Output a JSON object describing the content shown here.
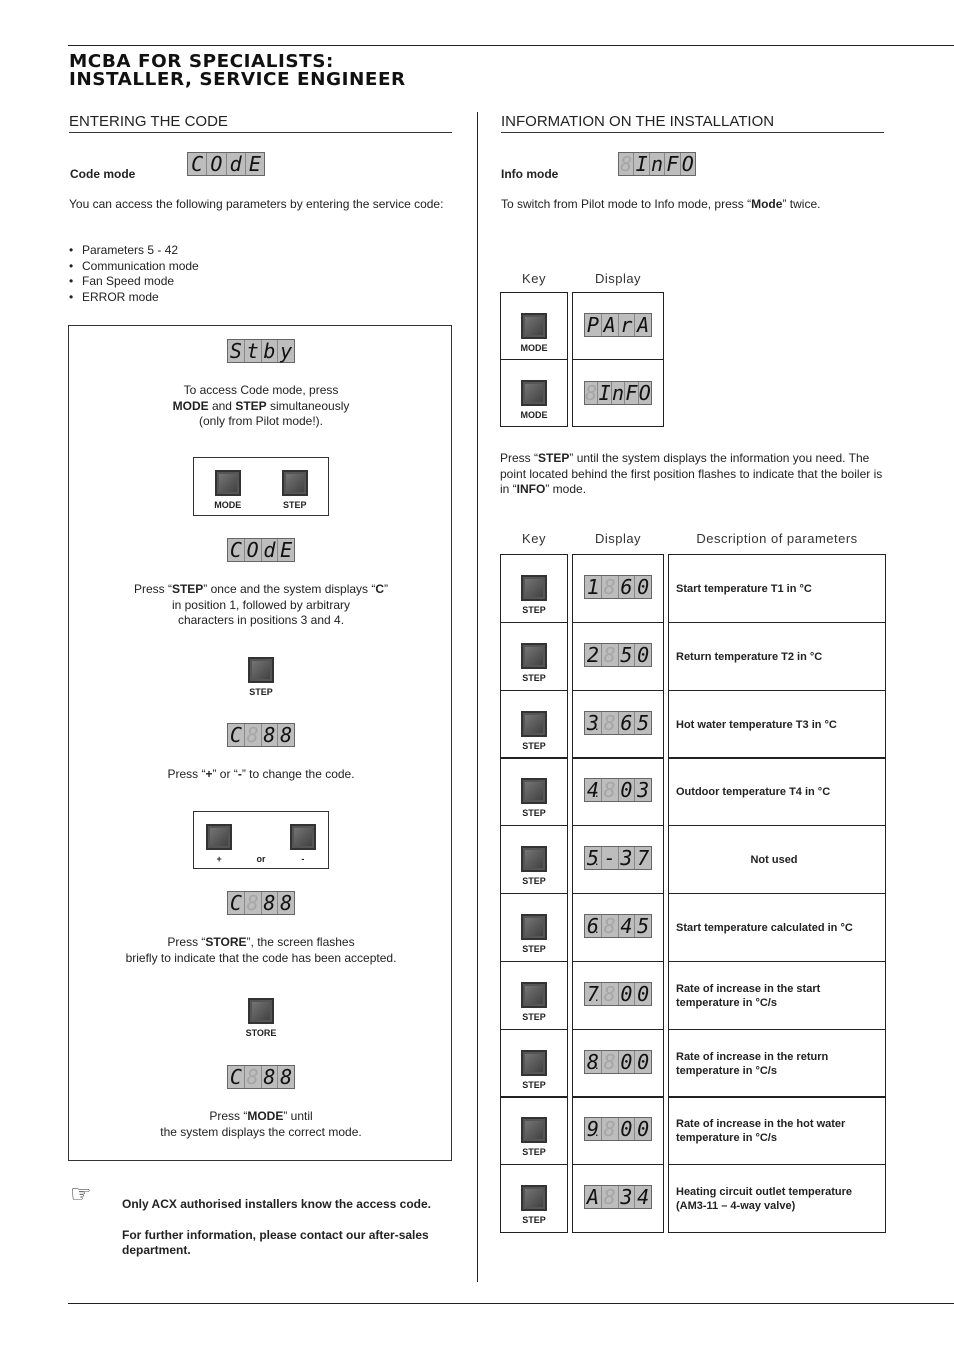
{
  "header": {
    "title_line1": "MCBA FOR SPECIALISTS:",
    "title_line2": "INSTALLER, SERVICE ENGINEER"
  },
  "left": {
    "section_title": "ENTERING THE CODE",
    "code_mode_label": "Code mode",
    "code_mode_display": [
      "C",
      "O",
      "d",
      "E"
    ],
    "intro": "You can access the following parameters by entering the service code:",
    "bullets": [
      "Parameters 5 - 42",
      "Communication mode",
      "Fan Speed mode",
      "ERROR mode"
    ],
    "panel": {
      "display_stby": [
        "S",
        "t",
        "b",
        "y"
      ],
      "step1_line1": "To access Code mode, press",
      "step1_b1": "MODE",
      "step1_and": " and ",
      "step1_b2": "STEP",
      "step1_rest": " simultaneously",
      "step1_line3": "(only from Pilot mode!).",
      "keys_mode": "MODE",
      "keys_step": "STEP",
      "display_code": [
        "C",
        "O",
        "d",
        "E"
      ],
      "step2_pre": "Press “",
      "step2_b": "STEP",
      "step2_mid": "” once and the system displays “",
      "step2_b2": "C",
      "step2_end": "”",
      "step2_line2": "in position 1, followed by arbitrary",
      "step2_line3": "characters in positions 3 and 4.",
      "key_step": "STEP",
      "display_c88": [
        "C",
        "8",
        "8",
        "8"
      ],
      "step3_pre": "Press “",
      "step3_plus": "+",
      "step3_mid": "” or “",
      "step3_minus": "-",
      "step3_end": "” to change the code.",
      "key_plus": "+",
      "key_or": "or",
      "key_minus": "-",
      "step4_pre": "Press “",
      "step4_b": "STORE",
      "step4_end": "”, the screen flashes",
      "step4_line2": "briefly to indicate that the code has been accepted.",
      "key_store": "STORE",
      "step5_pre": "Press “",
      "step5_b": "MODE",
      "step5_end": "” until",
      "step5_line2": "the system displays the correct mode."
    },
    "note_line1": "Only ACX authorised installers know the access code.",
    "note_line2": "For further information, please contact our after-sales department."
  },
  "right": {
    "section_title": "INFORMATION ON THE INSTALLATION",
    "info_mode_label": "Info mode",
    "info_mode_display": [
      "8",
      "I",
      "n",
      "F",
      "O"
    ],
    "switch_pre": "To switch from Pilot mode to Info mode, press “",
    "switch_b": "Mode",
    "switch_end": "” twice.",
    "small_table": {
      "col_key": "Key",
      "col_display": "Display",
      "rows": [
        {
          "key": "MODE",
          "display": [
            "P",
            "A",
            "r",
            "A"
          ]
        },
        {
          "key": "MODE",
          "display": [
            "8",
            "I",
            "n",
            "F",
            "O"
          ]
        }
      ]
    },
    "step_para_pre": "Press “",
    "step_para_b": "STEP",
    "step_para_mid": "” until the system displays the information you need. The point located behind the first position flashes to indicate that the boiler is in “",
    "step_para_b2": "INFO",
    "step_para_end": "” mode.",
    "param_table": {
      "col_key": "Key",
      "col_display": "Display",
      "col_desc": "Description of parameters",
      "rows": [
        {
          "key": "STEP",
          "display": "1.60",
          "digits": [
            "1",
            "8",
            "6",
            "0"
          ],
          "desc": "Start temperature T1 in °C"
        },
        {
          "key": "STEP",
          "display": "2.50",
          "digits": [
            "2",
            "8",
            "5",
            "0"
          ],
          "desc": "Return temperature T2 in °C"
        },
        {
          "key": "STEP",
          "display": "3.65",
          "digits": [
            "3",
            "8",
            "6",
            "5"
          ],
          "desc": "Hot water temperature T3 in °C"
        },
        {
          "key": "STEP",
          "display": "4.03",
          "digits": [
            "4",
            "8",
            "0",
            "3"
          ],
          "desc": "Outdoor temperature T4 in °C"
        },
        {
          "key": "STEP",
          "display": "5.-37",
          "digits": [
            "5",
            "-",
            "3",
            "7"
          ],
          "desc": "Not used"
        },
        {
          "key": "STEP",
          "display": "6.45",
          "digits": [
            "6",
            "8",
            "4",
            "5"
          ],
          "desc": "Start temperature calculated in °C"
        },
        {
          "key": "STEP",
          "display": "7.00",
          "digits": [
            "7",
            "8",
            "0",
            "0"
          ],
          "desc": "Rate of increase in the start temperature in °C/s"
        },
        {
          "key": "STEP",
          "display": "8.00",
          "digits": [
            "8",
            "8",
            "0",
            "0"
          ],
          "desc": "Rate of increase in the return temperature in °C/s"
        },
        {
          "key": "STEP",
          "display": "9.00",
          "digits": [
            "9",
            "8",
            "0",
            "0"
          ],
          "desc": "Rate of increase in the hot water temperature in °C/s"
        },
        {
          "key": "STEP",
          "display": "A.34",
          "digits": [
            "A",
            "8",
            "3",
            "4"
          ],
          "desc": "Heating circuit outlet temperature (AM3-11 – 4-way valve)"
        }
      ]
    }
  }
}
